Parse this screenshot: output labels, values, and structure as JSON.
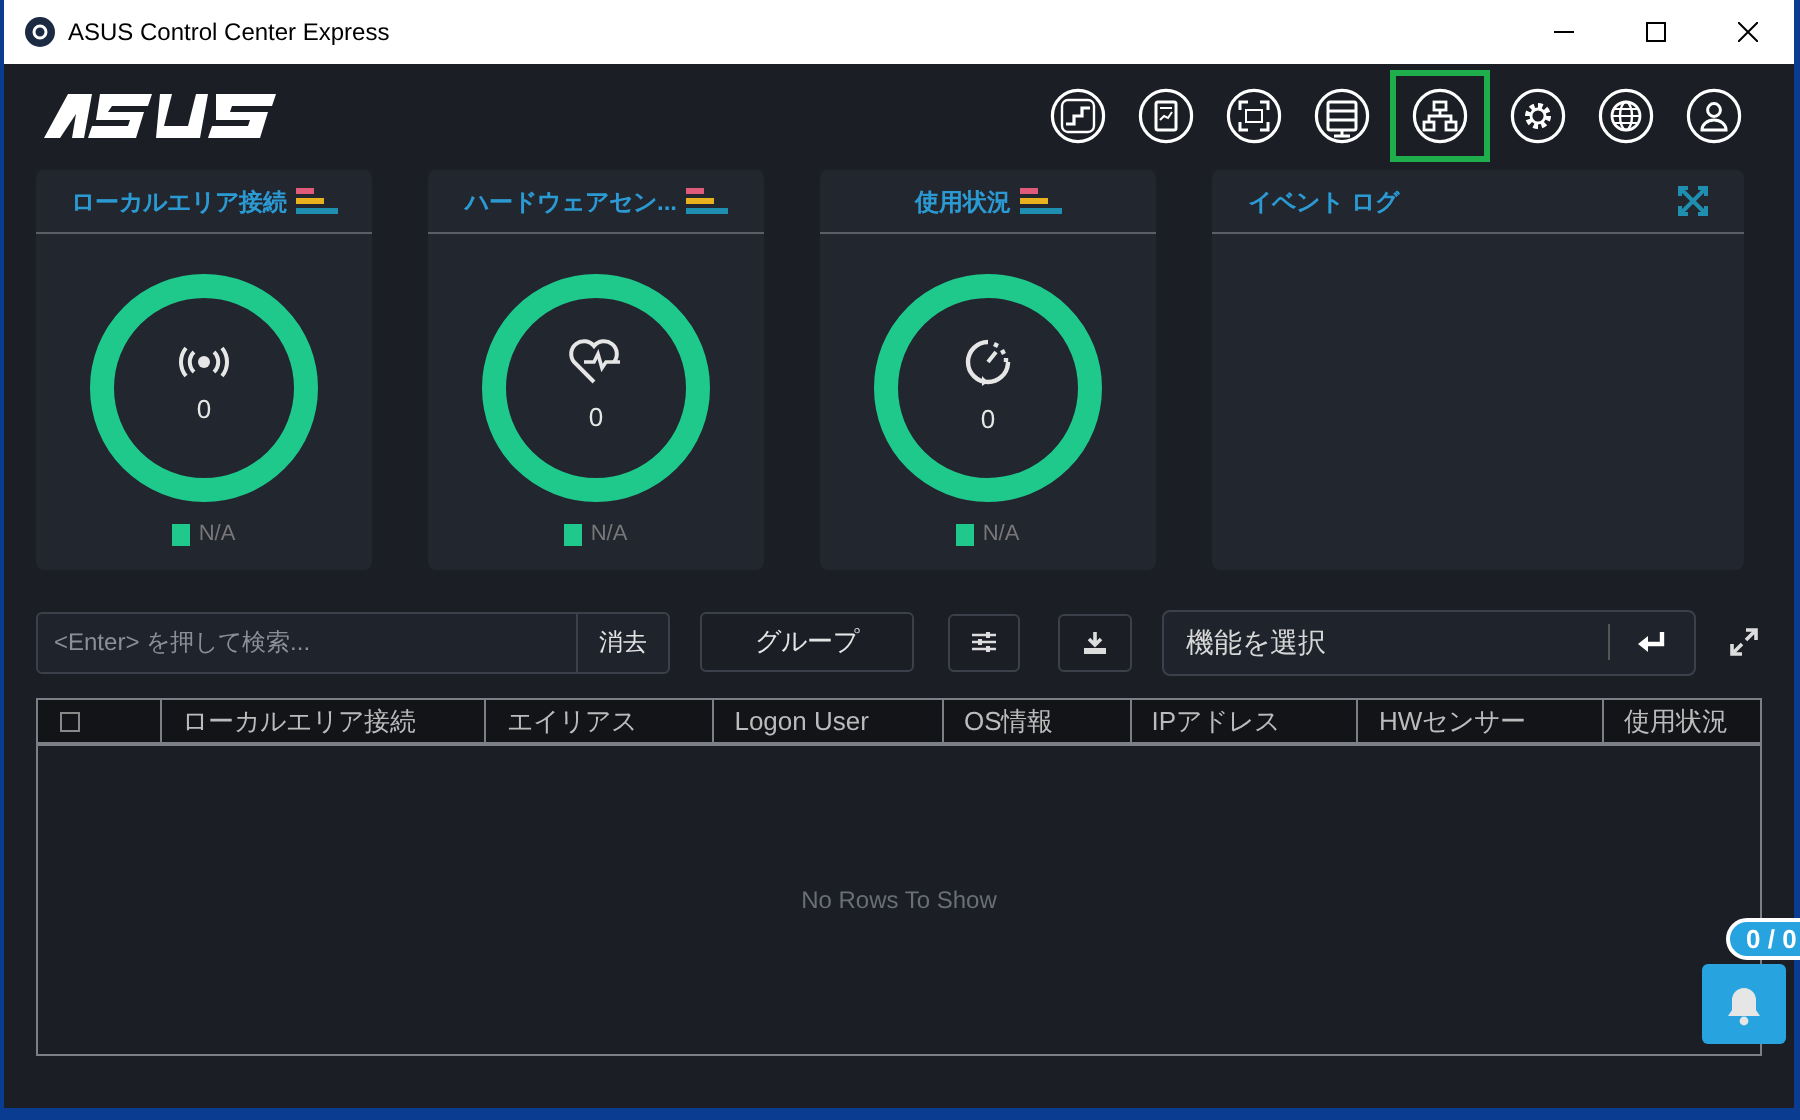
{
  "window": {
    "title": "ASUS Control Center Express"
  },
  "nav_icons": [
    {
      "kind": "stairs",
      "selected": false
    },
    {
      "kind": "report",
      "selected": false
    },
    {
      "kind": "scan",
      "selected": false
    },
    {
      "kind": "list",
      "selected": false
    },
    {
      "kind": "hierarchy",
      "selected": true
    },
    {
      "kind": "gear",
      "selected": false
    },
    {
      "kind": "globe",
      "selected": false
    },
    {
      "kind": "user",
      "selected": false
    }
  ],
  "cards": [
    {
      "title": "ローカルエリア接続",
      "kind": "network",
      "value": "0",
      "legend": "N/A"
    },
    {
      "title": "ハードウェアセン...",
      "kind": "health",
      "value": "0",
      "legend": "N/A"
    },
    {
      "title": "使用状況",
      "kind": "speed",
      "value": "0",
      "legend": "N/A"
    }
  ],
  "event_log": {
    "title": "イベント ログ"
  },
  "search": {
    "placeholder": "<Enter> を押して検索...",
    "clear": "消去"
  },
  "group_button": "グループ",
  "function_select": {
    "placeholder": "機能を選択"
  },
  "table": {
    "select_all": {
      "checked": false
    },
    "columns": [
      "ローカルエリア接続",
      "エイリアス",
      "Logon User",
      "OS情報",
      "IPアドレス",
      "HWセンサー",
      "使用状況"
    ],
    "empty_message": "No Rows To Show"
  },
  "notifications": {
    "count": "0 / 0"
  }
}
